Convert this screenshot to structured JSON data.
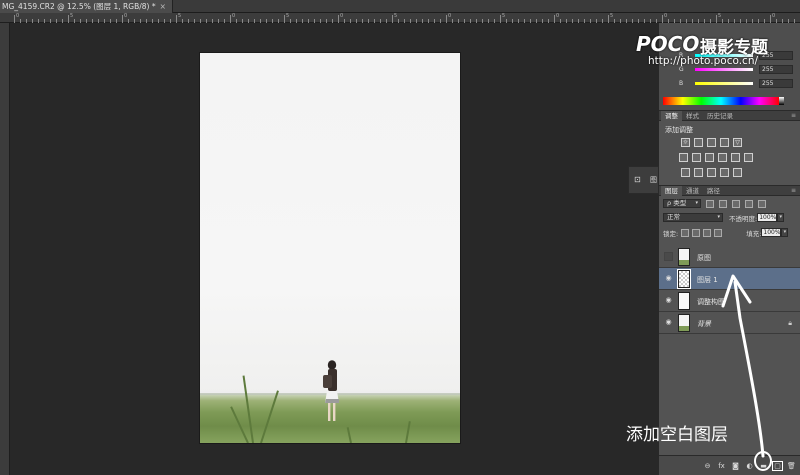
{
  "document_tab": {
    "title": "MG_4159.CR2 @ 12.5% (图层 1, RGB/8) *",
    "close_glyph": "×"
  },
  "ruler": {
    "top_numbers": [
      "0",
      "5",
      "0",
      "5",
      "0",
      "5",
      "0",
      "5",
      "0",
      "5",
      "0",
      "5",
      "0",
      "5",
      "0"
    ]
  },
  "watermark": {
    "brand": "POCO",
    "brand_cn": "摄影专题",
    "url": "http://photo.poco.cn/"
  },
  "color_panel": {
    "channels": [
      {
        "label": "R",
        "value": "255",
        "gradient": [
          "#00ffff",
          "#ffffff"
        ]
      },
      {
        "label": "G",
        "value": "255",
        "gradient": [
          "#ff00ff",
          "#ffffff"
        ]
      },
      {
        "label": "B",
        "value": "255",
        "gradient": [
          "#ffff00",
          "#ffffff"
        ]
      }
    ]
  },
  "adjust_panel": {
    "tabs": [
      "调整",
      "样式",
      "历史记录"
    ],
    "title": "添加调整",
    "row1_icons": [
      "brightness-icon",
      "levels-icon",
      "curves-icon",
      "exposure-icon",
      "vibrance-icon"
    ],
    "row2_icons": [
      "hue-saturation-icon",
      "color-balance-icon",
      "black-white-icon",
      "photo-filter-icon",
      "channel-mixer-icon",
      "color-lookup-icon"
    ],
    "row3_icons": [
      "invert-icon",
      "posterize-icon",
      "threshold-icon",
      "gradient-map-icon",
      "selective-color-icon"
    ]
  },
  "side_dock": {
    "label": "图"
  },
  "layers_panel": {
    "tabs": [
      "图层",
      "通道",
      "路径"
    ],
    "filter_kind": "ρ 类型",
    "blend_mode": "正常",
    "opacity_label": "不透明度:",
    "opacity_value": "100%",
    "lock_label": "锁定:",
    "fill_label": "填充:",
    "fill_value": "100%",
    "layers": [
      {
        "name": "原图",
        "visible": false,
        "selected": false,
        "thumb": "photo",
        "italic": false,
        "locked": false
      },
      {
        "name": "图层 1",
        "visible": true,
        "selected": true,
        "thumb": "checker",
        "italic": false,
        "locked": false
      },
      {
        "name": "调整构图",
        "visible": true,
        "selected": false,
        "thumb": "white",
        "italic": false,
        "locked": false
      },
      {
        "name": "背景",
        "visible": true,
        "selected": false,
        "thumb": "photo",
        "italic": true,
        "locked": true
      }
    ],
    "footer_icons": [
      "link-icon",
      "fx-icon",
      "mask-icon",
      "adjustment-layer-icon",
      "group-folder-icon",
      "new-layer-icon",
      "trash-icon"
    ]
  },
  "annotation": {
    "text": "添加空白图层"
  }
}
